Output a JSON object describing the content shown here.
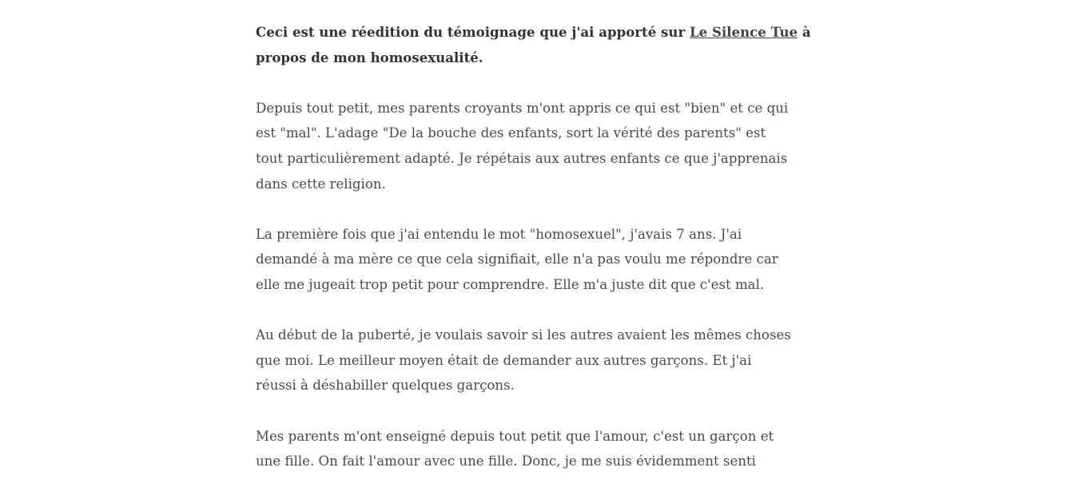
{
  "intro": {
    "before_link": "Ceci est une réedition du témoignage que j'ai apporté sur ",
    "link": "Le Silence Tue",
    "after_link": " à",
    "line2": "propos de mon homosexualité."
  },
  "paragraphs": [
    {
      "lines": [
        "Depuis tout petit, mes parents croyants m'ont appris ce qui est \"bien\" et ce qui",
        "est \"mal\". L'adage \"De la bouche des enfants, sort la vérité des parents\" est",
        "tout particulièrement adapté. Je répétais aux autres enfants ce que j'apprenais",
        "dans cette religion."
      ]
    },
    {
      "lines": [
        "La première fois que j'ai entendu le mot \"homosexuel\", j'avais 7 ans. J'ai",
        "demandé à ma mère ce que cela signifiait, elle n'a pas voulu me répondre car",
        "elle me jugeait trop petit pour comprendre. Elle m'a juste dit que c'est mal."
      ]
    },
    {
      "lines": [
        "Au début de la puberté, je voulais savoir si les autres avaient les mêmes choses",
        "que moi. Le meilleur moyen était de demander aux autres garçons. Et j'ai",
        "réussi à déshabiller quelques garçons."
      ]
    },
    {
      "lines": [
        "Mes parents m'ont enseigné depuis tout petit que l'amour, c'est un garçon et",
        "une fille. On fait l'amour avec une fille. Donc, je me suis évidemment senti"
      ]
    }
  ]
}
